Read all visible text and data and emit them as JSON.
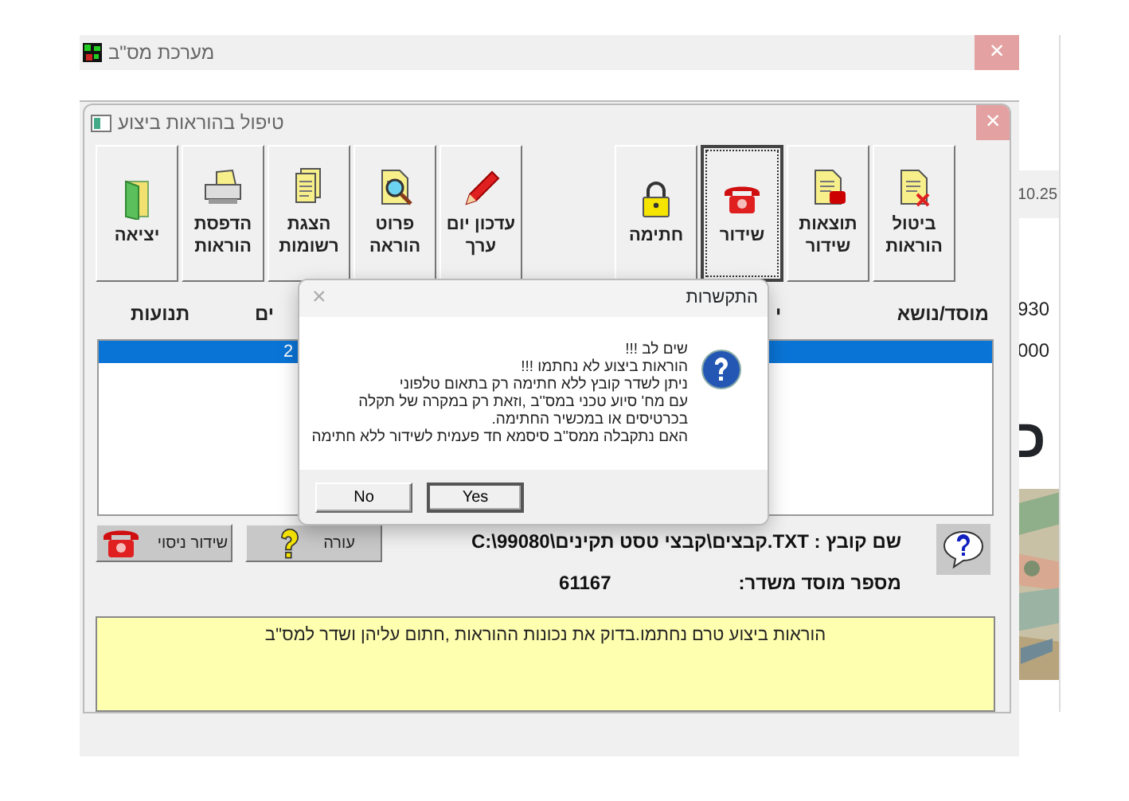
{
  "outer_window": {
    "title": "מערכת מס\"ב",
    "close": "×"
  },
  "background_app": {
    "texts": [
      "10.25",
      "930",
      "000",
      "כ"
    ],
    "photo": {
      "kind": "picture"
    }
  },
  "window": {
    "title": "טיפול בהוראות ביצוע",
    "close": "×"
  },
  "toolbar": [
    {
      "buttons": [
        {
          "label": "ביטול הוראות",
          "kind": "cancel",
          "focused": false
        },
        {
          "label": "תוצאות שידור",
          "kind": "results",
          "focused": false
        },
        {
          "label": "שידור",
          "kind": "phone",
          "focused": true
        },
        {
          "label": "חתימה",
          "kind": "lock",
          "focused": false
        }
      ]
    },
    {
      "buttons": [
        {
          "label": "עדכון יום ערך",
          "kind": "pencil",
          "focused": false
        },
        {
          "label": "פרוט הוראה",
          "kind": "magnifier",
          "focused": false
        },
        {
          "label": "הצגת רשומות",
          "kind": "documents",
          "focused": false
        },
        {
          "label": "הדפסת הוראות",
          "kind": "printer",
          "focused": false
        },
        {
          "label": "יציאה",
          "kind": "exit",
          "focused": false
        }
      ]
    }
  ],
  "columns": [
    "מוסד/נושא",
    "י",
    "ים",
    "תנועות"
  ],
  "list": {
    "rows": [
      {
        "cells": [
          "2"
        ],
        "selected": true
      }
    ]
  },
  "dialog": {
    "title": "התקשרות",
    "close": "×",
    "message": "שים לב !!!\nהוראות ביצוע לא נחתמו !!!\nניתן לשדר קובץ ללא חתימה רק בתאום טלפוני\nעם מח' סיוע טכני במס''ב ,וזאת רק במקרה של תקלה\nבכרטיסים או במכשיר החתימה.\nהאם נתקבלה ממס''ב סיסמא חד פעמית לשידור ללא חתימה",
    "buttons": [
      {
        "label": "Yes",
        "default": true
      },
      {
        "label": "No",
        "default": false
      }
    ]
  },
  "file_name": "שם קובץ : TXT.קבצים\\קבצי טסט תקינים\\C:\\99080",
  "institution": {
    "label": "מספר מוסד משדר:",
    "value": "61167"
  },
  "actions": [
    {
      "label": "עורה",
      "kind": "help"
    },
    {
      "label": "שידור ניסוי",
      "kind": "phone"
    }
  ],
  "message": "הוראות ביצוע טרם נחתמו.בדוק את נכונות ההוראות ,חתום עליהן ושדר למס''ב"
}
